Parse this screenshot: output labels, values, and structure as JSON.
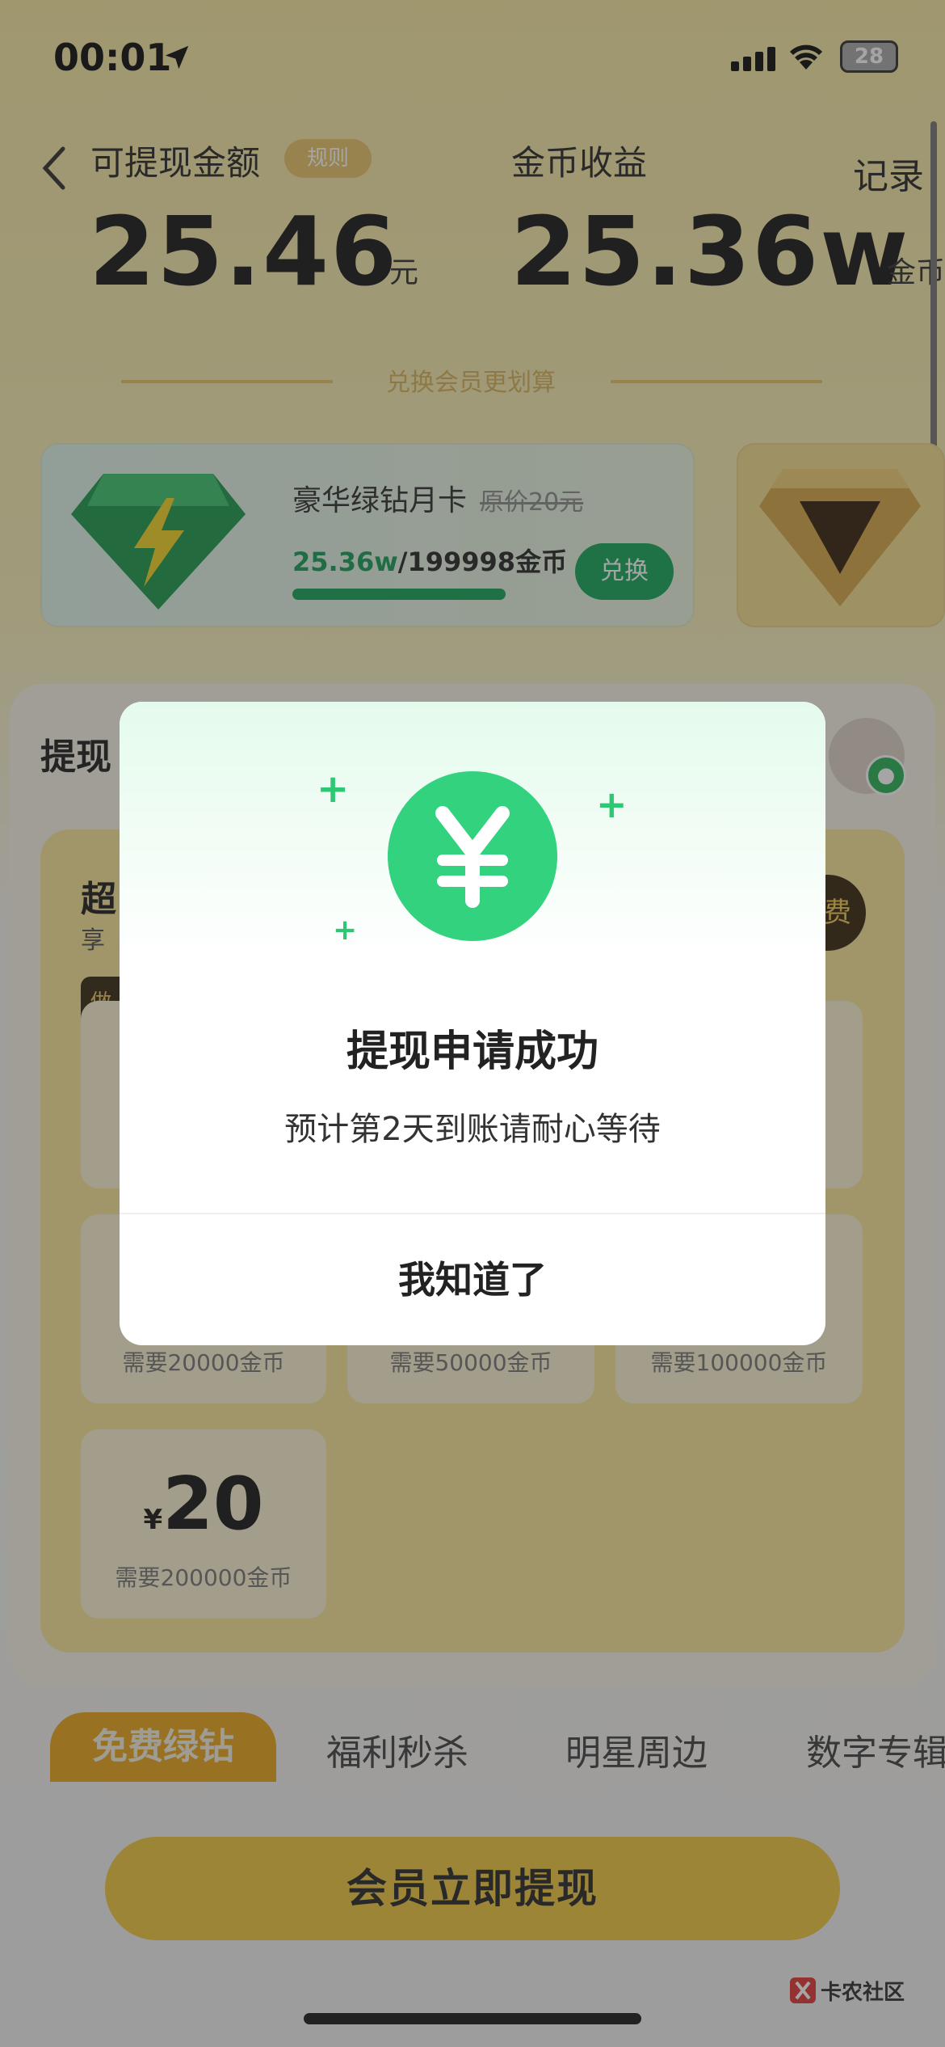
{
  "status_bar": {
    "time": "00:01",
    "battery": "28"
  },
  "header": {
    "withdraw_label": "可提现金额",
    "rule_badge": "规则",
    "amount_value": "25.46",
    "amount_unit": "元",
    "coins_label": "金币收益",
    "coins_value": "25.36w",
    "coins_unit": "金币",
    "record_link": "记录"
  },
  "exchange_caption": "兑换会员更划算",
  "member_card": {
    "title": "豪华绿钻月卡",
    "original_price": "原价20元",
    "progress_current": "25.36w",
    "progress_total": "/199998金币",
    "progress": 1.0,
    "button": "兑换",
    "accent": "#17a85b"
  },
  "panel": {
    "title": "提现",
    "super_title": "超",
    "super_sub": "享",
    "tag": "做",
    "side_pill": "费",
    "tiles": [
      {
        "need": "需要20000金币"
      },
      {
        "need": "需要50000金币"
      },
      {
        "need": "需要100000金币"
      }
    ],
    "tile_20": {
      "currency": "¥",
      "amount": "20",
      "need": "需要200000金币"
    }
  },
  "tabs": [
    "免费绿钻",
    "福利秒杀",
    "明星周边",
    "数字专辑"
  ],
  "cta_button": "会员立即提现",
  "watermark": "卡农社区",
  "modal": {
    "title": "提现申请成功",
    "description": "预计第2天到账请耐心等待",
    "button": "我知道了",
    "icon": "yen-icon",
    "accent": "#33d27f"
  }
}
